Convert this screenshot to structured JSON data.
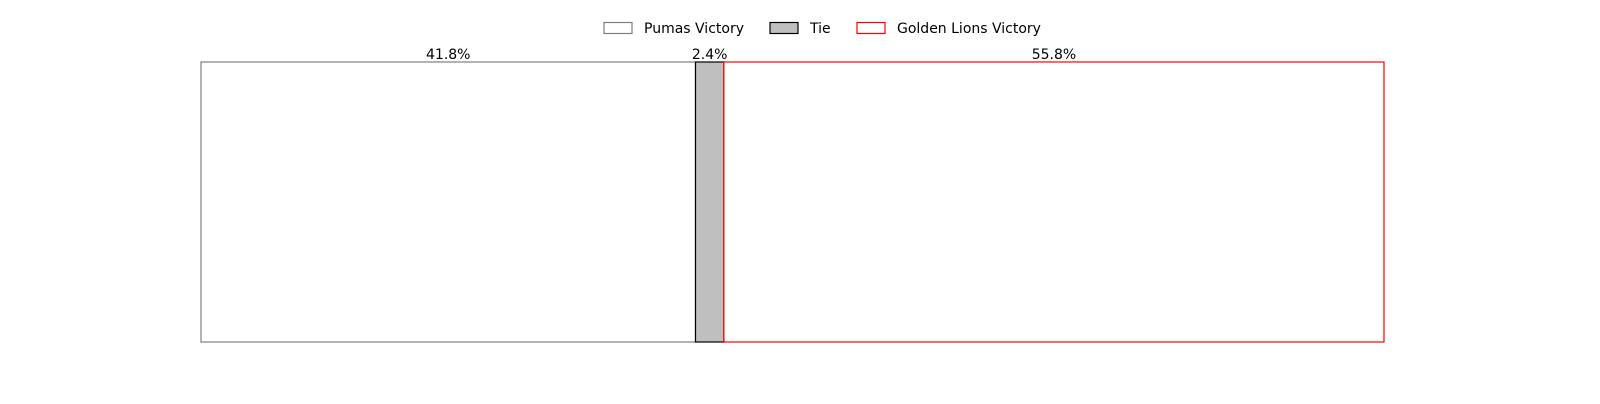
{
  "chart_data": {
    "type": "bar",
    "orientation": "horizontal-stacked",
    "title": "",
    "xlabel": "",
    "ylabel": "",
    "xlim": [
      0,
      100
    ],
    "grid": false,
    "legend_position": "top-center",
    "categories": [
      ""
    ],
    "series": [
      {
        "name": "Pumas Victory",
        "values": [
          41.8
        ],
        "label": "41.8%",
        "fill": "#ffffff",
        "stroke": "#808080"
      },
      {
        "name": "Tie",
        "values": [
          2.4
        ],
        "label": "2.4%",
        "fill": "#bfbfbf",
        "stroke": "#000000"
      },
      {
        "name": "Golden Lions Victory",
        "values": [
          55.8
        ],
        "label": "55.8%",
        "fill": "#ffffff",
        "stroke": "#ff0000"
      }
    ]
  }
}
